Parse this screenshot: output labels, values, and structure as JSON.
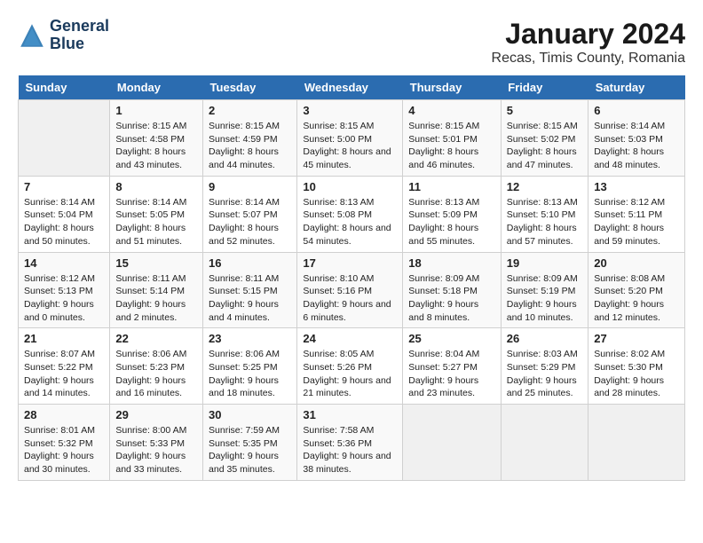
{
  "logo": {
    "line1": "General",
    "line2": "Blue"
  },
  "title": "January 2024",
  "subtitle": "Recas, Timis County, Romania",
  "days_of_week": [
    "Sunday",
    "Monday",
    "Tuesday",
    "Wednesday",
    "Thursday",
    "Friday",
    "Saturday"
  ],
  "weeks": [
    [
      {
        "day": "",
        "sunrise": "",
        "sunset": "",
        "daylight": ""
      },
      {
        "day": "1",
        "sunrise": "Sunrise: 8:15 AM",
        "sunset": "Sunset: 4:58 PM",
        "daylight": "Daylight: 8 hours and 43 minutes."
      },
      {
        "day": "2",
        "sunrise": "Sunrise: 8:15 AM",
        "sunset": "Sunset: 4:59 PM",
        "daylight": "Daylight: 8 hours and 44 minutes."
      },
      {
        "day": "3",
        "sunrise": "Sunrise: 8:15 AM",
        "sunset": "Sunset: 5:00 PM",
        "daylight": "Daylight: 8 hours and 45 minutes."
      },
      {
        "day": "4",
        "sunrise": "Sunrise: 8:15 AM",
        "sunset": "Sunset: 5:01 PM",
        "daylight": "Daylight: 8 hours and 46 minutes."
      },
      {
        "day": "5",
        "sunrise": "Sunrise: 8:15 AM",
        "sunset": "Sunset: 5:02 PM",
        "daylight": "Daylight: 8 hours and 47 minutes."
      },
      {
        "day": "6",
        "sunrise": "Sunrise: 8:14 AM",
        "sunset": "Sunset: 5:03 PM",
        "daylight": "Daylight: 8 hours and 48 minutes."
      }
    ],
    [
      {
        "day": "7",
        "sunrise": "Sunrise: 8:14 AM",
        "sunset": "Sunset: 5:04 PM",
        "daylight": "Daylight: 8 hours and 50 minutes."
      },
      {
        "day": "8",
        "sunrise": "Sunrise: 8:14 AM",
        "sunset": "Sunset: 5:05 PM",
        "daylight": "Daylight: 8 hours and 51 minutes."
      },
      {
        "day": "9",
        "sunrise": "Sunrise: 8:14 AM",
        "sunset": "Sunset: 5:07 PM",
        "daylight": "Daylight: 8 hours and 52 minutes."
      },
      {
        "day": "10",
        "sunrise": "Sunrise: 8:13 AM",
        "sunset": "Sunset: 5:08 PM",
        "daylight": "Daylight: 8 hours and 54 minutes."
      },
      {
        "day": "11",
        "sunrise": "Sunrise: 8:13 AM",
        "sunset": "Sunset: 5:09 PM",
        "daylight": "Daylight: 8 hours and 55 minutes."
      },
      {
        "day": "12",
        "sunrise": "Sunrise: 8:13 AM",
        "sunset": "Sunset: 5:10 PM",
        "daylight": "Daylight: 8 hours and 57 minutes."
      },
      {
        "day": "13",
        "sunrise": "Sunrise: 8:12 AM",
        "sunset": "Sunset: 5:11 PM",
        "daylight": "Daylight: 8 hours and 59 minutes."
      }
    ],
    [
      {
        "day": "14",
        "sunrise": "Sunrise: 8:12 AM",
        "sunset": "Sunset: 5:13 PM",
        "daylight": "Daylight: 9 hours and 0 minutes."
      },
      {
        "day": "15",
        "sunrise": "Sunrise: 8:11 AM",
        "sunset": "Sunset: 5:14 PM",
        "daylight": "Daylight: 9 hours and 2 minutes."
      },
      {
        "day": "16",
        "sunrise": "Sunrise: 8:11 AM",
        "sunset": "Sunset: 5:15 PM",
        "daylight": "Daylight: 9 hours and 4 minutes."
      },
      {
        "day": "17",
        "sunrise": "Sunrise: 8:10 AM",
        "sunset": "Sunset: 5:16 PM",
        "daylight": "Daylight: 9 hours and 6 minutes."
      },
      {
        "day": "18",
        "sunrise": "Sunrise: 8:09 AM",
        "sunset": "Sunset: 5:18 PM",
        "daylight": "Daylight: 9 hours and 8 minutes."
      },
      {
        "day": "19",
        "sunrise": "Sunrise: 8:09 AM",
        "sunset": "Sunset: 5:19 PM",
        "daylight": "Daylight: 9 hours and 10 minutes."
      },
      {
        "day": "20",
        "sunrise": "Sunrise: 8:08 AM",
        "sunset": "Sunset: 5:20 PM",
        "daylight": "Daylight: 9 hours and 12 minutes."
      }
    ],
    [
      {
        "day": "21",
        "sunrise": "Sunrise: 8:07 AM",
        "sunset": "Sunset: 5:22 PM",
        "daylight": "Daylight: 9 hours and 14 minutes."
      },
      {
        "day": "22",
        "sunrise": "Sunrise: 8:06 AM",
        "sunset": "Sunset: 5:23 PM",
        "daylight": "Daylight: 9 hours and 16 minutes."
      },
      {
        "day": "23",
        "sunrise": "Sunrise: 8:06 AM",
        "sunset": "Sunset: 5:25 PM",
        "daylight": "Daylight: 9 hours and 18 minutes."
      },
      {
        "day": "24",
        "sunrise": "Sunrise: 8:05 AM",
        "sunset": "Sunset: 5:26 PM",
        "daylight": "Daylight: 9 hours and 21 minutes."
      },
      {
        "day": "25",
        "sunrise": "Sunrise: 8:04 AM",
        "sunset": "Sunset: 5:27 PM",
        "daylight": "Daylight: 9 hours and 23 minutes."
      },
      {
        "day": "26",
        "sunrise": "Sunrise: 8:03 AM",
        "sunset": "Sunset: 5:29 PM",
        "daylight": "Daylight: 9 hours and 25 minutes."
      },
      {
        "day": "27",
        "sunrise": "Sunrise: 8:02 AM",
        "sunset": "Sunset: 5:30 PM",
        "daylight": "Daylight: 9 hours and 28 minutes."
      }
    ],
    [
      {
        "day": "28",
        "sunrise": "Sunrise: 8:01 AM",
        "sunset": "Sunset: 5:32 PM",
        "daylight": "Daylight: 9 hours and 30 minutes."
      },
      {
        "day": "29",
        "sunrise": "Sunrise: 8:00 AM",
        "sunset": "Sunset: 5:33 PM",
        "daylight": "Daylight: 9 hours and 33 minutes."
      },
      {
        "day": "30",
        "sunrise": "Sunrise: 7:59 AM",
        "sunset": "Sunset: 5:35 PM",
        "daylight": "Daylight: 9 hours and 35 minutes."
      },
      {
        "day": "31",
        "sunrise": "Sunrise: 7:58 AM",
        "sunset": "Sunset: 5:36 PM",
        "daylight": "Daylight: 9 hours and 38 minutes."
      },
      {
        "day": "",
        "sunrise": "",
        "sunset": "",
        "daylight": ""
      },
      {
        "day": "",
        "sunrise": "",
        "sunset": "",
        "daylight": ""
      },
      {
        "day": "",
        "sunrise": "",
        "sunset": "",
        "daylight": ""
      }
    ]
  ]
}
